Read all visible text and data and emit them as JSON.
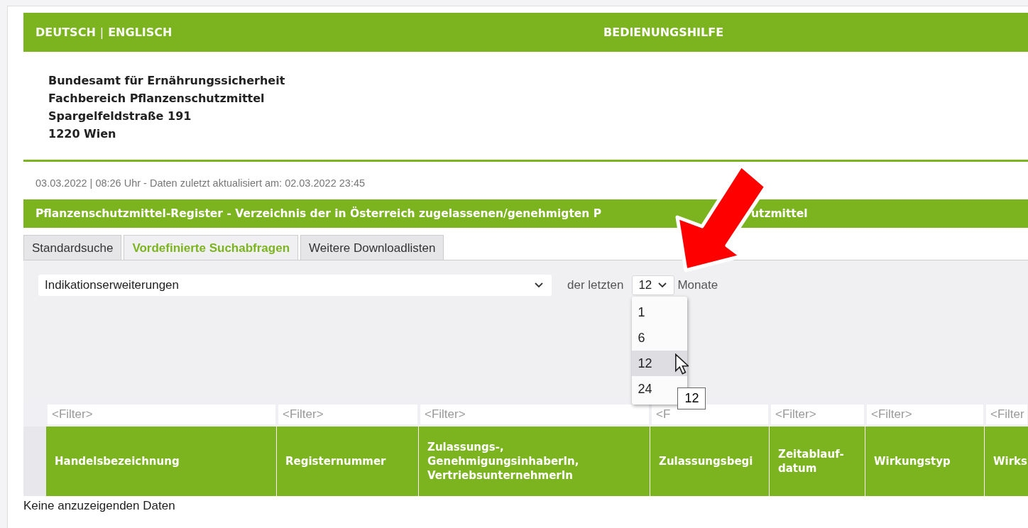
{
  "header": {
    "languages": [
      {
        "label": "DEUTSCH"
      },
      {
        "label": "ENGLISCH"
      }
    ],
    "separator": "|",
    "help_link": "BEDIENUNGSHILFE"
  },
  "address": [
    "Bundesamt für Ernährungssicherheit",
    "Fachbereich Pflanzenschutzmittel",
    "Spargelfeldstraße 191",
    "1220 Wien"
  ],
  "status_line": "03.03.2022 | 08:26 Uhr  - Daten zuletzt aktualisiert am: 02.03.2022 23:45",
  "register": {
    "title_start": "Pflanzenschutzmittel-Register - Verzeichnis der in Österreich zugelassenen/genehmigten P",
    "title_end": "utzmittel"
  },
  "tabs": [
    {
      "label": "Standardsuche",
      "selected": false
    },
    {
      "label": "Vordefinierte Suchabfragen",
      "selected": true
    },
    {
      "label": "Weitere Downloadlisten",
      "selected": false
    }
  ],
  "query_select": {
    "value": "Indikationserweiterungen"
  },
  "period": {
    "prefix": "der letzten",
    "value": "12",
    "suffix": "Monate",
    "expanded": true,
    "options": [
      {
        "label": "1",
        "selected": false
      },
      {
        "label": "6",
        "selected": false
      },
      {
        "label": "12",
        "selected": true
      },
      {
        "label": "24",
        "selected": false
      }
    ],
    "tooltip": "12"
  },
  "table": {
    "columns": [
      {
        "heading": "Handelsbezeichnung",
        "filter": "<Filter>"
      },
      {
        "heading": "Registernummer",
        "filter": "<Filter>"
      },
      {
        "heading": "Zulassungs-, GenehmigungsinhaberIn, VertriebsunternehmerIn",
        "filter": "<Filter>"
      },
      {
        "heading": "Zulassungsbegi",
        "filter": "<F"
      },
      {
        "heading": "Zeitablauf-datum",
        "filter": "<Filter>"
      },
      {
        "heading": "Wirkungstyp",
        "filter": "<Filter>"
      },
      {
        "heading": "Wirks",
        "filter": "<Filter"
      }
    ],
    "empty_message": "Keine anzuzeigenden Daten"
  }
}
